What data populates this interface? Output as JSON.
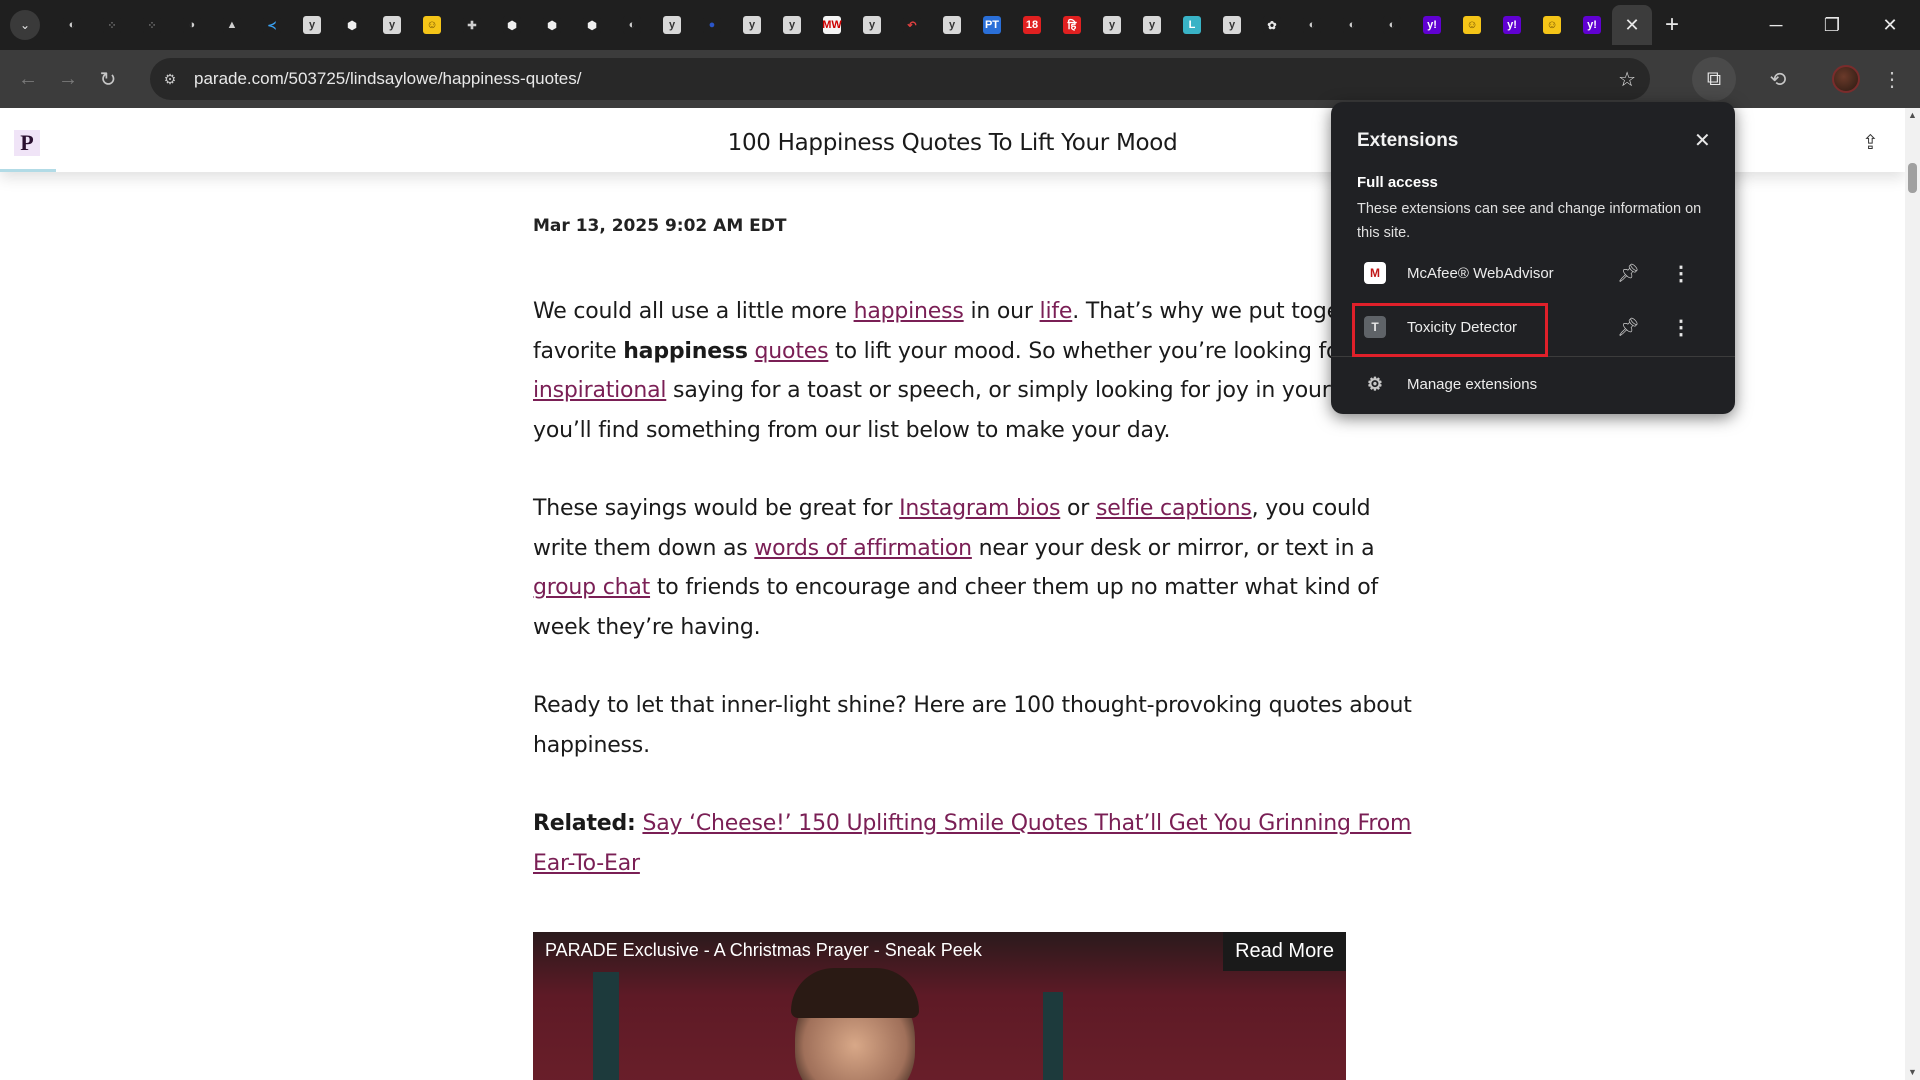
{
  "tabs": {
    "favicons": [
      {
        "name": "globe-tab",
        "glyph": "◐",
        "bg": "#1f1f1f",
        "fg": "#cfcfcf"
      },
      {
        "name": "dots-tab",
        "glyph": "⁘",
        "bg": "#1f1f1f",
        "fg": "#6a6a6a"
      },
      {
        "name": "dots-tab-2",
        "glyph": "⁘",
        "bg": "#1f1f1f",
        "fg": "#6a6a6a"
      },
      {
        "name": "globe-tab-2",
        "glyph": "◑",
        "bg": "#1f1f1f",
        "fg": "#cfcfcf"
      },
      {
        "name": "drive-tab",
        "glyph": "▲",
        "bg": "#1f1f1f",
        "fg": "#cfcfcf"
      },
      {
        "name": "vscode-tab",
        "glyph": "≺",
        "bg": "#1f1f1f",
        "fg": "#3aa0f0"
      },
      {
        "name": "y-tab",
        "glyph": "y",
        "bg": "#d8d8d8",
        "fg": "#333"
      },
      {
        "name": "cube-tab",
        "glyph": "⬢",
        "bg": "#1f1f1f",
        "fg": "#f0f0f0"
      },
      {
        "name": "y-tab-2",
        "glyph": "y",
        "bg": "#d8d8d8",
        "fg": "#333"
      },
      {
        "name": "hugging-tab",
        "glyph": "☺",
        "bg": "#f5c518",
        "fg": "#6a4a00"
      },
      {
        "name": "puzzle-tab",
        "glyph": "✚",
        "bg": "#1f1f1f",
        "fg": "#cfcfcf"
      },
      {
        "name": "cube-tab-2",
        "glyph": "⬢",
        "bg": "#1f1f1f",
        "fg": "#f0f0f0"
      },
      {
        "name": "cube-tab-3",
        "glyph": "⬢",
        "bg": "#1f1f1f",
        "fg": "#f0f0f0"
      },
      {
        "name": "cube-tab-4",
        "glyph": "⬢",
        "bg": "#1f1f1f",
        "fg": "#f0f0f0"
      },
      {
        "name": "globe-tab-3",
        "glyph": "◐",
        "bg": "#1f1f1f",
        "fg": "#cfcfcf"
      },
      {
        "name": "y-tab-3",
        "glyph": "y",
        "bg": "#d8d8d8",
        "fg": "#333"
      },
      {
        "name": "blue-circle-tab",
        "glyph": "●",
        "bg": "#1f1f1f",
        "fg": "#2a55c8"
      },
      {
        "name": "y-tab-4",
        "glyph": "y",
        "bg": "#d8d8d8",
        "fg": "#333"
      },
      {
        "name": "y-tab-5",
        "glyph": "y",
        "bg": "#d8d8d8",
        "fg": "#333"
      },
      {
        "name": "mw-tab",
        "glyph": "MW",
        "bg": "#f5f5f5",
        "fg": "#c00"
      },
      {
        "name": "y-tab-6",
        "glyph": "y",
        "bg": "#d8d8d8",
        "fg": "#333"
      },
      {
        "name": "reply-tab",
        "glyph": "↶",
        "bg": "#1f1f1f",
        "fg": "#e04040"
      },
      {
        "name": "y-tab-7",
        "glyph": "y",
        "bg": "#d8d8d8",
        "fg": "#333"
      },
      {
        "name": "pt-tab",
        "glyph": "PT",
        "bg": "#2a6fd8",
        "fg": "#fff"
      },
      {
        "name": "18-tab",
        "glyph": "18",
        "bg": "#e02020",
        "fg": "#fff"
      },
      {
        "name": "hi-tab",
        "glyph": "हि",
        "bg": "#e02020",
        "fg": "#fff"
      },
      {
        "name": "y-tab-8",
        "glyph": "y",
        "bg": "#d8d8d8",
        "fg": "#333"
      },
      {
        "name": "y-tab-9",
        "glyph": "y",
        "bg": "#d8d8d8",
        "fg": "#333"
      },
      {
        "name": "l-tab",
        "glyph": "L",
        "bg": "#39b3c6",
        "fg": "#fff"
      },
      {
        "name": "y-tab-10",
        "glyph": "y",
        "bg": "#d8d8d8",
        "fg": "#333"
      },
      {
        "name": "openai-tab",
        "glyph": "✿",
        "bg": "#1f1f1f",
        "fg": "#e8e8e8"
      },
      {
        "name": "globe-tab-4",
        "glyph": "◐",
        "bg": "#1f1f1f",
        "fg": "#cfcfcf"
      },
      {
        "name": "globe-tab-5",
        "glyph": "◐",
        "bg": "#1f1f1f",
        "fg": "#cfcfcf"
      },
      {
        "name": "globe-tab-6",
        "glyph": "◐",
        "bg": "#1f1f1f",
        "fg": "#cfcfcf"
      },
      {
        "name": "yahoo-tab",
        "glyph": "y!",
        "bg": "#6001d2",
        "fg": "#fff"
      },
      {
        "name": "hugging-tab-2",
        "glyph": "☺",
        "bg": "#f5c518",
        "fg": "#6a4a00"
      },
      {
        "name": "yahoo-tab-2",
        "glyph": "y!",
        "bg": "#6001d2",
        "fg": "#fff"
      },
      {
        "name": "hugging-tab-3",
        "glyph": "☺",
        "bg": "#f5c518",
        "fg": "#6a4a00"
      },
      {
        "name": "yahoo-tab-3",
        "glyph": "y!",
        "bg": "#6001d2",
        "fg": "#fff"
      }
    ],
    "active_close": "✕",
    "new_tab": "+"
  },
  "toolbar": {
    "url": "parade.com/503725/lindsaylowe/happiness-quotes/"
  },
  "header": {
    "title": "100 Happiness Quotes To Lift Your Mood",
    "logo": "P"
  },
  "article": {
    "date": "Mar 13, 2025 9:02 AM EDT",
    "p1": {
      "l1_a": "We could all use a little more ",
      "l1_link1": "happiness",
      "l1_b": " in our ",
      "l1_link2": "life",
      "l1_c": ". That’s why we put together o",
      "l2_a": "favorite ",
      "l2_bold": "happiness",
      "l2_sp": " ",
      "l2_link": "quotes",
      "l2_b": " to lift your mood. So whether you’re looking for an",
      "l3_link": "inspirational",
      "l3_b": " saying for a toast or speech, or simply looking for joy in your own",
      "l4": "you’ll find something from our list below to make your day."
    },
    "p2": {
      "l1_a": "These sayings would be great for ",
      "l1_link1": "Instagram bios",
      "l1_b": " or ",
      "l1_link2": "selfie captions",
      "l1_c": ", you could",
      "l2_a": "write them down as ",
      "l2_link": "words of affirmation",
      "l2_b": " near your desk or mirror, or text in a",
      "l3_link": "group chat",
      "l3_b": " to friends to encourage and cheer them up no matter what kind of",
      "l4": "week they’re having."
    },
    "p3": {
      "l1": "Ready to let that inner-light shine? Here are 100 thought-provoking quotes about",
      "l2": "happiness."
    },
    "p4": {
      "label": "Related:",
      "link_l1": "Say ‘Cheese!’ 150 Uplifting Smile Quotes That’ll Get You Grinning From",
      "link_l2": "Ear-To-Ear"
    },
    "video": {
      "title": "PARADE Exclusive - A Christmas Prayer - Sneak Peek",
      "read_more": "Read More"
    }
  },
  "extensions_panel": {
    "title": "Extensions",
    "section": "Full access",
    "description": "These extensions can see and change information on this site.",
    "items": [
      {
        "name": "McAfee® WebAdvisor",
        "icon": "M",
        "icon_bg": "#ffffff",
        "icon_fg": "#c01818"
      },
      {
        "name": "Toxicity Detector",
        "icon": "T",
        "icon_bg": "#5f6368",
        "icon_fg": "#e8e8e8"
      }
    ],
    "manage": "Manage extensions"
  }
}
